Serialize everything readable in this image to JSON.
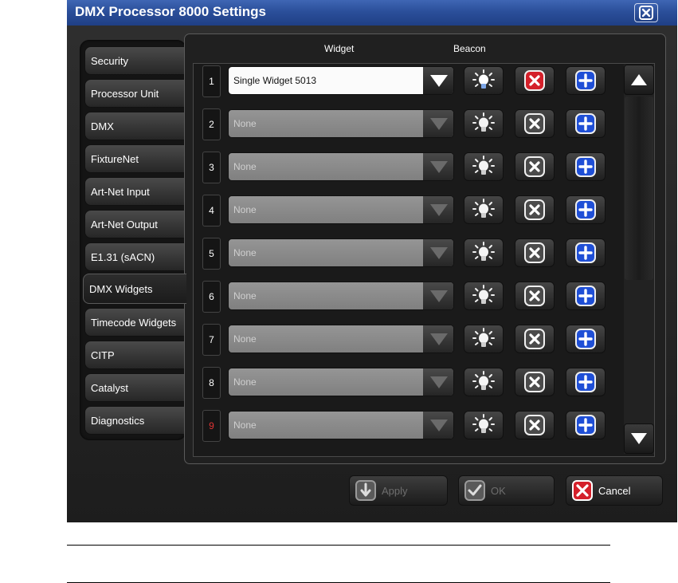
{
  "window": {
    "title": "DMX Processor 8000 Settings"
  },
  "tabs": [
    {
      "label": "Security"
    },
    {
      "label": "Processor Unit"
    },
    {
      "label": "DMX"
    },
    {
      "label": "FixtureNet"
    },
    {
      "label": "Art-Net Input"
    },
    {
      "label": "Art-Net Output"
    },
    {
      "label": "E1.31 (sACN)"
    },
    {
      "label": "DMX Widgets",
      "active": true
    },
    {
      "label": "Timecode Widgets"
    },
    {
      "label": "CITP"
    },
    {
      "label": "Catalyst"
    },
    {
      "label": "Diagnostics"
    }
  ],
  "columns": {
    "widget": "Widget",
    "beacon": "Beacon"
  },
  "rows": [
    {
      "num": "1",
      "value": "Single Widget 5013",
      "active": true
    },
    {
      "num": "2",
      "value": "None"
    },
    {
      "num": "3",
      "value": "None"
    },
    {
      "num": "4",
      "value": "None"
    },
    {
      "num": "5",
      "value": "None"
    },
    {
      "num": "6",
      "value": "None"
    },
    {
      "num": "7",
      "value": "None"
    },
    {
      "num": "8",
      "value": "None"
    },
    {
      "num": "9",
      "value": "None",
      "highlight": true
    }
  ],
  "buttons": {
    "apply": "Apply",
    "ok": "OK",
    "cancel": "Cancel"
  },
  "colors": {
    "title_bar": "#2b4f9a",
    "active_remove": "#d4202a",
    "add": "#1f4fd6",
    "row9_number": "#e03434"
  },
  "icons": {
    "beacon": "lightbulb-icon",
    "remove": "x-icon",
    "add": "plus-icon",
    "dropdown": "triangle-down-icon"
  }
}
